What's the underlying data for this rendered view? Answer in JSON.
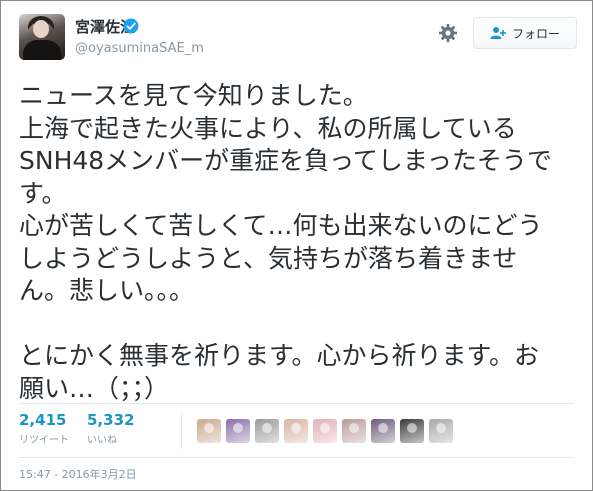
{
  "user": {
    "display_name": "宮澤佐江",
    "handle": "@oyasuminaSAE_m",
    "verified": true
  },
  "actions": {
    "follow_label": "フォロー",
    "settings_icon": "gear-icon"
  },
  "tweet": {
    "lines": [
      "ニュースを見て今知りました。",
      "上海で起きた火事により、私の所属している",
      "SNH48メンバーが重症を負ってしまったそうで",
      "す。",
      "心が苦しくて苦しくて…何も出来ないのにどう",
      "しようどうしようと、気持ちが落ち着きませ",
      "ん。悲しい。。。",
      "",
      "とにかく無事を祈ります。心から祈ります。お",
      "願い…（；；）"
    ]
  },
  "stats": {
    "retweets": {
      "count": "2,415",
      "label": "リツイート"
    },
    "likes": {
      "count": "5,332",
      "label": "いいね"
    }
  },
  "likers": [
    {
      "color": "#c9a98a"
    },
    {
      "color": "#8a6fa8"
    },
    {
      "color": "#9a9a9a"
    },
    {
      "color": "#d8b4a4"
    },
    {
      "color": "#e3b0b8"
    },
    {
      "color": "#b99a9a"
    },
    {
      "color": "#6c5a7a"
    },
    {
      "color": "#3b3b3b"
    },
    {
      "color": "#a8a8a8"
    }
  ],
  "timestamp": "15:47 - 2016年3月2日",
  "colors": {
    "accent": "#1b95c7",
    "verified": "#1da1f2",
    "muted": "#8899a6",
    "text": "#292f33"
  }
}
